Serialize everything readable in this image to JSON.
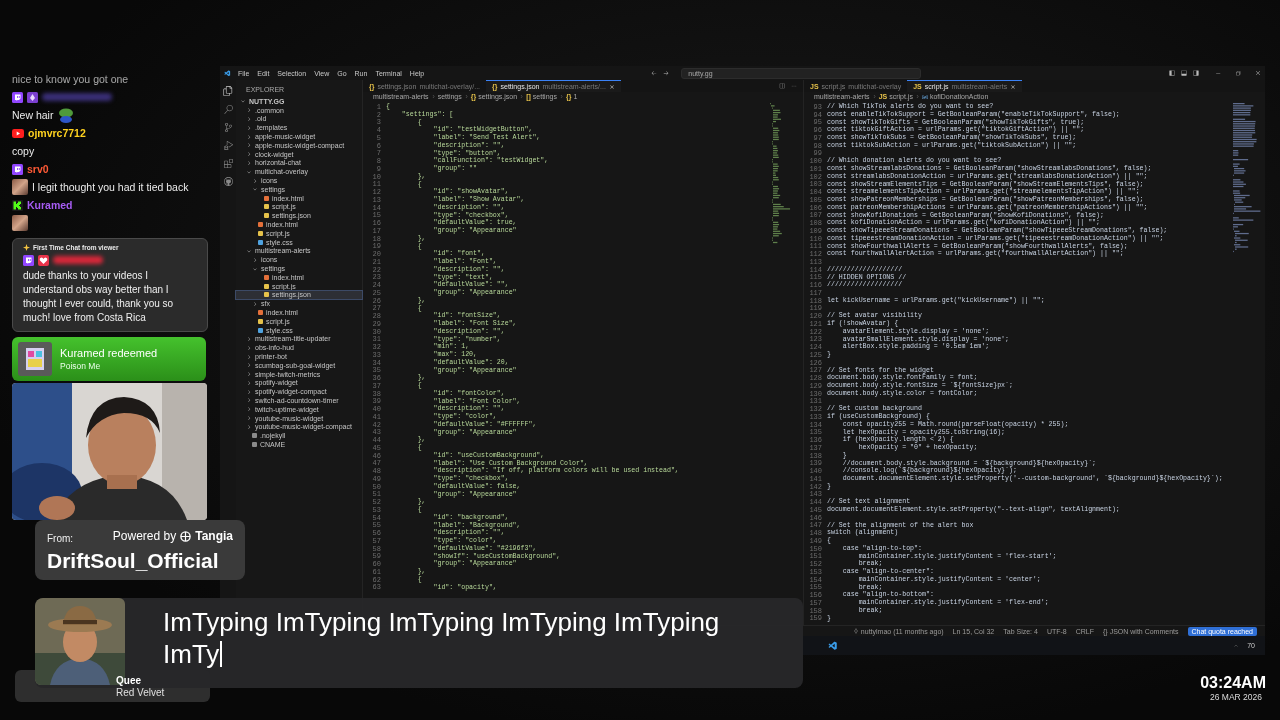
{
  "chat": {
    "messages": [
      {
        "kind": "text",
        "text": "nice to know you got one"
      },
      {
        "kind": "twitch-hidden-user"
      },
      {
        "kind": "text-emote",
        "text": "New hair"
      },
      {
        "kind": "youtube-user",
        "name": "ojmvrc7712",
        "color": "#ffd21f"
      },
      {
        "kind": "text",
        "text": "copy"
      },
      {
        "kind": "twitch-user",
        "name": "srv0",
        "color": "#ff5a36"
      },
      {
        "kind": "avatar-text",
        "text": "I legit thought you had it tied back"
      },
      {
        "kind": "kick-user",
        "name": "Kuramed",
        "color": "#a65cf2"
      },
      {
        "kind": "emote"
      }
    ],
    "highlight": {
      "badge": "First Time Chat from viewer",
      "text": "dude thanks to your videos I understand obs way better than I thought I ever could, thank you so much! love from Costa Rica"
    },
    "redemption": {
      "title": "Kuramed redeemed",
      "reward": "Poison Me"
    }
  },
  "alert": {
    "from_label": "From:",
    "powered_by": "Powered by",
    "brand": "Tangia",
    "sender": "DriftSoul_Official"
  },
  "tts": {
    "text": "ImTyping ImTyping ImTyping ImTyping ImTyping ImTy"
  },
  "now_playing": {
    "title": "Quee",
    "artist": "Red Velvet"
  },
  "clock": {
    "time": "03:24AM",
    "date": "26 MAR 2026"
  },
  "editor": {
    "menu": [
      "File",
      "Edit",
      "Selection",
      "View",
      "Go",
      "Run",
      "Terminal",
      "Help"
    ],
    "search": "nutty.gg",
    "explorer": {
      "title": "EXPLORER",
      "tree": [
        {
          "name": "NUTTY.GG",
          "kind": "folder",
          "expanded": true,
          "selected": false,
          "children": [
            {
              "name": ".common",
              "kind": "folder",
              "expanded": false,
              "selected": false
            },
            {
              "name": ".old",
              "kind": "folder",
              "expanded": false,
              "selected": false
            },
            {
              "name": ".templates",
              "kind": "folder",
              "expanded": false,
              "selected": false
            },
            {
              "name": "apple-music-widget",
              "kind": "folder",
              "expanded": false,
              "selected": false
            },
            {
              "name": "apple-music-widget-compact",
              "kind": "folder",
              "expanded": false,
              "selected": false
            },
            {
              "name": "clock-widget",
              "kind": "folder",
              "expanded": false,
              "selected": false
            },
            {
              "name": "horizontal-chat",
              "kind": "folder",
              "expanded": false,
              "selected": false
            },
            {
              "name": "multichat-overlay",
              "kind": "folder",
              "expanded": true,
              "selected": false,
              "children": [
                {
                  "name": "icons",
                  "kind": "folder",
                  "expanded": false,
                  "selected": false
                },
                {
                  "name": "settings",
                  "kind": "folder",
                  "expanded": true,
                  "selected": false,
                  "children": [
                    {
                      "name": "index.html",
                      "kind": "html",
                      "selected": false
                    },
                    {
                      "name": "script.js",
                      "kind": "js",
                      "selected": false
                    },
                    {
                      "name": "settings.json",
                      "kind": "json",
                      "selected": false
                    }
                  ]
                },
                {
                  "name": "index.html",
                  "kind": "html",
                  "selected": false
                },
                {
                  "name": "script.js",
                  "kind": "js",
                  "selected": false
                },
                {
                  "name": "style.css",
                  "kind": "css",
                  "selected": false
                }
              ]
            },
            {
              "name": "multistream-alerts",
              "kind": "folder",
              "expanded": true,
              "selected": false,
              "children": [
                {
                  "name": "icons",
                  "kind": "folder",
                  "expanded": false,
                  "selected": false
                },
                {
                  "name": "settings",
                  "kind": "folder",
                  "expanded": true,
                  "selected": false,
                  "children": [
                    {
                      "name": "index.html",
                      "kind": "html",
                      "selected": false
                    },
                    {
                      "name": "script.js",
                      "kind": "js",
                      "selected": false
                    },
                    {
                      "name": "settings.json",
                      "kind": "json",
                      "selected": true
                    }
                  ]
                },
                {
                  "name": "sfx",
                  "kind": "folder",
                  "expanded": false,
                  "selected": false
                },
                {
                  "name": "index.html",
                  "kind": "html",
                  "selected": false
                },
                {
                  "name": "script.js",
                  "kind": "js",
                  "selected": false
                },
                {
                  "name": "style.css",
                  "kind": "css",
                  "selected": false
                }
              ]
            },
            {
              "name": "multistream-title-updater",
              "kind": "folder",
              "expanded": false,
              "selected": false
            },
            {
              "name": "obs-info-hud",
              "kind": "folder",
              "expanded": false,
              "selected": false
            },
            {
              "name": "printer-bot",
              "kind": "folder",
              "expanded": false,
              "selected": false
            },
            {
              "name": "scumbag-sub-goal-widget",
              "kind": "folder",
              "expanded": false,
              "selected": false
            },
            {
              "name": "simple-twitch-metrics",
              "kind": "folder",
              "expanded": false,
              "selected": false
            },
            {
              "name": "spotify-widget",
              "kind": "folder",
              "expanded": false,
              "selected": false
            },
            {
              "name": "spotify-widget-compact",
              "kind": "folder",
              "expanded": false,
              "selected": false
            },
            {
              "name": "switch-ad-countdown-timer",
              "kind": "folder",
              "expanded": false,
              "selected": false
            },
            {
              "name": "twitch-uptime-widget",
              "kind": "folder",
              "expanded": false,
              "selected": false
            },
            {
              "name": "youtube-music-widget",
              "kind": "folder",
              "expanded": false,
              "selected": false
            },
            {
              "name": "youtube-music-widget-compact",
              "kind": "folder",
              "expanded": false,
              "selected": false
            },
            {
              "name": ".nojekyll",
              "kind": "file",
              "selected": false
            },
            {
              "name": "CNAME",
              "kind": "file",
              "selected": false
            }
          ]
        }
      ]
    },
    "panes": [
      {
        "kind": "json",
        "tabs": [
          {
            "glyph": "{}",
            "title": "settings.json",
            "hint": "multichat-overlay/...",
            "selected": false
          },
          {
            "glyph": "{}",
            "title": "settings.json",
            "hint": "multistream-alerts/...",
            "selected": true
          }
        ],
        "breadcrumb": [
          {
            "text": "multistream-alerts"
          },
          {
            "text": "settings"
          },
          {
            "glyph": "{}",
            "text": "settings.json"
          },
          {
            "glyph": "[]",
            "text": "settings"
          },
          {
            "glyph": "{}",
            "text": "1"
          }
        ],
        "lines": [
          {
            "number": "1",
            "code": "{"
          },
          {
            "number": "2",
            "code": "    \"settings\": ["
          },
          {
            "number": "3",
            "code": "        {"
          },
          {
            "number": "4",
            "code": "            \"id\": \"testWidgetButton\","
          },
          {
            "number": "5",
            "code": "            \"label\": \"Send Test Alert\","
          },
          {
            "number": "6",
            "code": "            \"description\": \"\","
          },
          {
            "number": "7",
            "code": "            \"type\": \"button\","
          },
          {
            "number": "8",
            "code": "            \"callFunction\": \"testWidget\","
          },
          {
            "number": "9",
            "code": "            \"group\": \"\""
          },
          {
            "number": "10",
            "code": "        },"
          },
          {
            "number": "11",
            "code": "        {"
          },
          {
            "number": "12",
            "code": "            \"id\": \"showAvatar\","
          },
          {
            "number": "13",
            "code": "            \"label\": \"Show Avatar\","
          },
          {
            "number": "14",
            "code": "            \"description\": \"\","
          },
          {
            "number": "15",
            "code": "            \"type\": \"checkbox\","
          },
          {
            "number": "16",
            "code": "            \"defaultValue\": true,"
          },
          {
            "number": "17",
            "code": "            \"group\": \"Appearance\""
          },
          {
            "number": "18",
            "code": "        },"
          },
          {
            "number": "19",
            "code": "        {"
          },
          {
            "number": "20",
            "code": "            \"id\": \"font\","
          },
          {
            "number": "21",
            "code": "            \"label\": \"Font\","
          },
          {
            "number": "22",
            "code": "            \"description\": \"\","
          },
          {
            "number": "23",
            "code": "            \"type\": \"text\","
          },
          {
            "number": "24",
            "code": "            \"defaultValue\": \"\","
          },
          {
            "number": "25",
            "code": "            \"group\": \"Appearance\""
          },
          {
            "number": "26",
            "code": "        },"
          },
          {
            "number": "27",
            "code": "        {"
          },
          {
            "number": "28",
            "code": "            \"id\": \"fontSize\","
          },
          {
            "number": "29",
            "code": "            \"label\": \"Font Size\","
          },
          {
            "number": "30",
            "code": "            \"description\": \"\","
          },
          {
            "number": "31",
            "code": "            \"type\": \"number\","
          },
          {
            "number": "32",
            "code": "            \"min\": 1,"
          },
          {
            "number": "33",
            "code": "            \"max\": 120,"
          },
          {
            "number": "34",
            "code": "            \"defaultValue\": 20,"
          },
          {
            "number": "35",
            "code": "            \"group\": \"Appearance\""
          },
          {
            "number": "36",
            "code": "        },"
          },
          {
            "number": "37",
            "code": "        {"
          },
          {
            "number": "38",
            "code": "            \"id\": \"fontColor\","
          },
          {
            "number": "39",
            "code": "            \"label\": \"Font Color\","
          },
          {
            "number": "40",
            "code": "            \"description\": \"\","
          },
          {
            "number": "41",
            "code": "            \"type\": \"color\","
          },
          {
            "number": "42",
            "code": "            \"defaultValue\": \"#FFFFFF\","
          },
          {
            "number": "43",
            "code": "            \"group\": \"Appearance\""
          },
          {
            "number": "44",
            "code": "        },"
          },
          {
            "number": "45",
            "code": "        {"
          },
          {
            "number": "46",
            "code": "            \"id\": \"useCustomBackground\","
          },
          {
            "number": "47",
            "code": "            \"label\": \"Use Custom Background Color\","
          },
          {
            "number": "48",
            "code": "            \"description\": \"If off, platform colors will be used instead\","
          },
          {
            "number": "49",
            "code": "            \"type\": \"checkbox\","
          },
          {
            "number": "50",
            "code": "            \"defaultValue\": false,"
          },
          {
            "number": "51",
            "code": "            \"group\": \"Appearance\""
          },
          {
            "number": "52",
            "code": "        },"
          },
          {
            "number": "53",
            "code": "        {"
          },
          {
            "number": "54",
            "code": "            \"id\": \"background\","
          },
          {
            "number": "55",
            "code": "            \"label\": \"Background\","
          },
          {
            "number": "56",
            "code": "            \"description\": \"\","
          },
          {
            "number": "57",
            "code": "            \"type\": \"color\","
          },
          {
            "number": "58",
            "code": "            \"defaultValue\": \"#2196f3\","
          },
          {
            "number": "59",
            "code": "            \"showIf\": \"useCustomBackground\","
          },
          {
            "number": "60",
            "code": "            \"group\": \"Appearance\""
          },
          {
            "number": "61",
            "code": "        },"
          },
          {
            "number": "62",
            "code": "        {"
          },
          {
            "number": "63",
            "code": "            \"id\": \"opacity\","
          }
        ]
      },
      {
        "kind": "javascript",
        "tabs": [
          {
            "glyph": "JS",
            "title": "script.js",
            "hint": "multichat-overlay",
            "selected": false
          },
          {
            "glyph": "JS",
            "title": "script.js",
            "hint": "multistream-alerts",
            "selected": true
          }
        ],
        "breadcrumb": [
          {
            "text": "multistream-alerts"
          },
          {
            "glyph": "JS",
            "text": "script.js"
          },
          {
            "kind": "variable",
            "text": "kofiDonationAction"
          }
        ],
        "lines": [
          {
            "number": "93",
            "code": "// Which TikTok alerts do you want to see?"
          },
          {
            "number": "94",
            "code": "const enableTikTokSupport = GetBooleanParam(\"enableTikTokSupport\", false);"
          },
          {
            "number": "95",
            "code": "const showTikTokGifts = GetBooleanParam(\"showTikTokGifts\", true);"
          },
          {
            "number": "96",
            "code": "const tiktokGiftAction = urlParams.get(\"tiktokGiftAction\") || \"\";"
          },
          {
            "number": "97",
            "code": "const showTikTokSubs = GetBooleanParam(\"showTikTokSubs\", true);"
          },
          {
            "number": "98",
            "code": "const tiktokSubAction = urlParams.get(\"tiktokSubAction\") || \"\";"
          },
          {
            "number": "99"
          },
          {
            "number": "100",
            "code": "// Which donation alerts do you want to see?"
          },
          {
            "number": "101",
            "code": "const showStreamlabsDonations = GetBooleanParam(\"showStreamlabsDonations\", false);"
          },
          {
            "number": "102",
            "code": "const streamlabsDonationAction = urlParams.get(\"streamlabsDonationAction\") || \"\";"
          },
          {
            "number": "103",
            "code": "const showStreamElementsTips = GetBooleanParam(\"showStreamElementsTips\", false);"
          },
          {
            "number": "104",
            "code": "const streamelementsTipAction = urlParams.get(\"streamelementsTipAction\") || \"\";"
          },
          {
            "number": "105",
            "code": "const showPatreonMemberships = GetBooleanParam(\"showPatreonMemberships\", false);"
          },
          {
            "number": "106",
            "code": "const patreonMembershipActions = urlParams.get(\"patreonMembershipActions\") || \"\";"
          },
          {
            "number": "107",
            "code": "const showKofiDonations = GetBooleanParam(\"showKofiDonations\", false);"
          },
          {
            "number": "108",
            "code": "const kofiDonationAction = urlParams.get(\"kofiDonationAction\") || \"\";"
          },
          {
            "number": "109",
            "code": "const showTipeeeStreamDonations = GetBooleanParam(\"showTipeeeStreamDonations\", false);"
          },
          {
            "number": "110",
            "code": "const tipeeestreamDonationAction = urlParams.get(\"tipeeestreamDonationAction\") || \"\";"
          },
          {
            "number": "111",
            "code": "const showFourthwallAlerts = GetBooleanParam(\"showFourthwallAlerts\", false);"
          },
          {
            "number": "112",
            "code": "const fourthwallAlertAction = urlParams.get(\"fourthwallAlertAction\") || \"\";"
          },
          {
            "number": "113"
          },
          {
            "number": "114",
            "code": "///////////////////"
          },
          {
            "number": "115",
            "code": "// HIDDEN OPTIONS //"
          },
          {
            "number": "116",
            "code": "///////////////////"
          },
          {
            "number": "117"
          },
          {
            "number": "118",
            "code": "let kickUsername = urlParams.get(\"kickUsername\") || \"\";"
          },
          {
            "number": "119"
          },
          {
            "number": "120",
            "code": "// Set avatar visibility"
          },
          {
            "number": "121",
            "code": "if (!showAvatar) {"
          },
          {
            "number": "122",
            "code": "    avatarElement.style.display = 'none';"
          },
          {
            "number": "123",
            "code": "    avatarSmallElement.style.display = 'none';"
          },
          {
            "number": "124",
            "code": "    alertBox.style.padding = '0.5em 1em';"
          },
          {
            "number": "125",
            "code": "}"
          },
          {
            "number": "126"
          },
          {
            "number": "127",
            "code": "// Set fonts for the widget"
          },
          {
            "number": "128",
            "code": "document.body.style.fontFamily = font;"
          },
          {
            "number": "129",
            "code": "document.body.style.fontSize = `${fontSize}px`;"
          },
          {
            "number": "130",
            "code": "document.body.style.color = fontColor;"
          },
          {
            "number": "131"
          },
          {
            "number": "132",
            "code": "// Set custom background"
          },
          {
            "number": "133",
            "code": "if (useCustomBackground) {"
          },
          {
            "number": "134",
            "code": "    const opacity255 = Math.round(parseFloat(opacity) * 255);"
          },
          {
            "number": "135",
            "code": "    let hexOpacity = opacity255.toString(16);"
          },
          {
            "number": "136",
            "code": "    if (hexOpacity.length < 2) {"
          },
          {
            "number": "137",
            "code": "        hexOpacity = \"0\" + hexOpacity;"
          },
          {
            "number": "138",
            "code": "    }"
          },
          {
            "number": "139",
            "code": "    //document.body.style.background = `${background}${hexOpacity}`;"
          },
          {
            "number": "140",
            "code": "    //console.log(`${background}${hexOpacity}`);"
          },
          {
            "number": "141",
            "code": "    document.documentElement.style.setProperty('--custom-background', `${background}${hexOpacity}`);"
          },
          {
            "number": "142",
            "code": "}"
          },
          {
            "number": "143"
          },
          {
            "number": "144",
            "code": "// Set text alignment"
          },
          {
            "number": "145",
            "code": "document.documentElement.style.setProperty(\"--text-align\", textAlignment);"
          },
          {
            "number": "146"
          },
          {
            "number": "147",
            "code": "// Set the alignment of the alert box"
          },
          {
            "number": "148",
            "code": "switch (alignment)"
          },
          {
            "number": "149",
            "code": "{"
          },
          {
            "number": "150",
            "code": "    case \"align-to-top\":"
          },
          {
            "number": "151",
            "code": "        mainContainer.style.justifyContent = 'flex-start';"
          },
          {
            "number": "152",
            "code": "        break;"
          },
          {
            "number": "153",
            "code": "    case \"align-to-center\":"
          },
          {
            "number": "154",
            "code": "        mainContainer.style.justifyContent = 'center';"
          },
          {
            "number": "155",
            "code": "        break;"
          },
          {
            "number": "156",
            "code": "    case \"align-to-bottom\":"
          },
          {
            "number": "157",
            "code": "        mainContainer.style.justifyContent = 'flex-end';"
          },
          {
            "number": "158",
            "code": "        break;"
          },
          {
            "number": "159",
            "code": "}"
          }
        ]
      }
    ],
    "status_bar": [
      {
        "kind": "blame",
        "text": "nuttylmao (11 months ago)"
      },
      {
        "kind": "text",
        "text": "Ln 15, Col 32"
      },
      {
        "kind": "text",
        "text": "Tab Size: 4"
      },
      {
        "kind": "text",
        "text": "UTF-8"
      },
      {
        "kind": "text",
        "text": "CRLF"
      },
      {
        "kind": "text",
        "text": "{} JSON with Comments"
      },
      {
        "kind": "badge",
        "text": "Chat quota reached"
      }
    ],
    "tray_text": "70"
  }
}
